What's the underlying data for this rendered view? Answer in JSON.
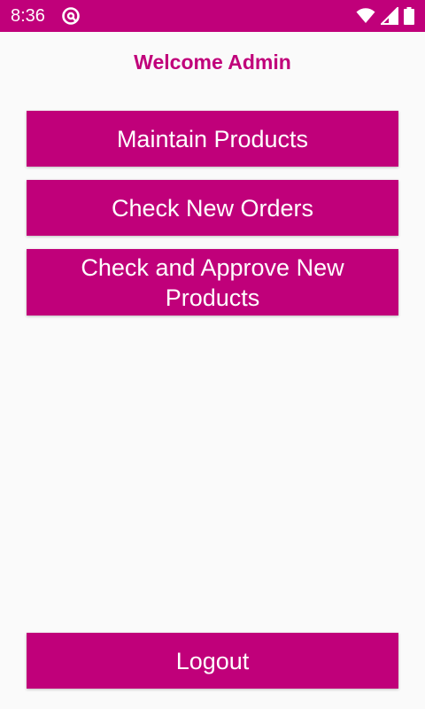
{
  "status_bar": {
    "time": "8:36",
    "app_icon": "at-sign-icon",
    "wifi_icon": "wifi-icon",
    "signal_icon": "cell-signal-icon",
    "battery_icon": "battery-icon"
  },
  "header": {
    "title": "Welcome Admin"
  },
  "menu": {
    "maintain_products": "Maintain Products",
    "check_new_orders": "Check New Orders",
    "approve_products": "Check and Approve New Products"
  },
  "footer": {
    "logout": "Logout"
  },
  "colors": {
    "accent": "#c0007a",
    "background": "#fafafa",
    "button_text": "#ffffff"
  }
}
